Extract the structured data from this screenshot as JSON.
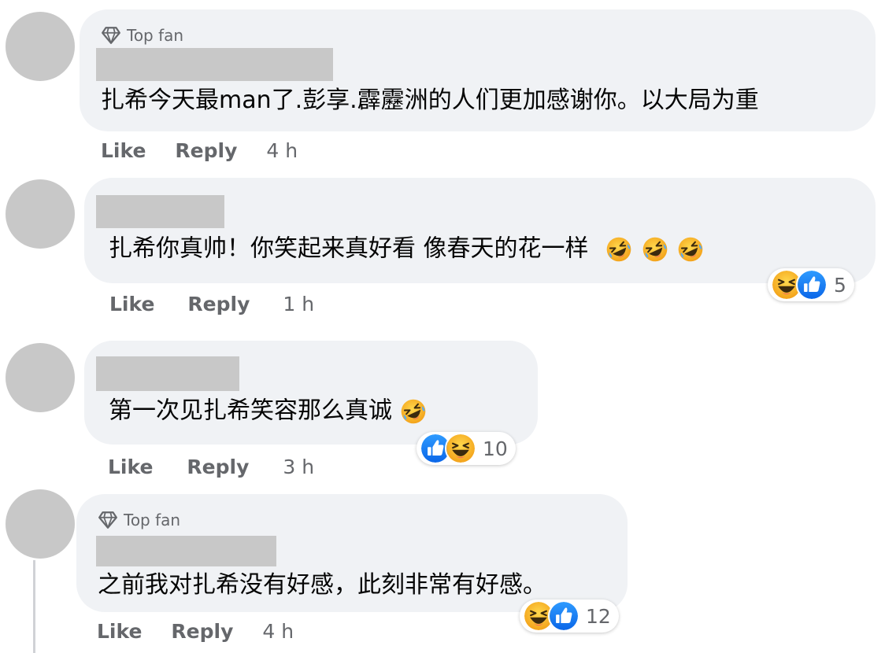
{
  "comments": [
    {
      "badge": "Top fan",
      "text": "扎希今天最man了.彭享.霹靂洲的人们更加感谢你。以大局为重",
      "like": "Like",
      "reply": "Reply",
      "time": "4 h"
    },
    {
      "text": "扎希你真帅！你笑起来真好看 像春天的花一样",
      "inline_emojis": [
        "rofl-emoji",
        "rofl-emoji",
        "rofl-emoji"
      ],
      "like": "Like",
      "reply": "Reply",
      "time": "1 h",
      "reactions": {
        "icons": [
          "haha-icon",
          "like-icon"
        ],
        "count": "5"
      }
    },
    {
      "text": "第一次见扎希笑容那么真诚",
      "inline_emojis": [
        "rofl-emoji"
      ],
      "like": "Like",
      "reply": "Reply",
      "time": "3 h",
      "reactions": {
        "icons": [
          "like-icon",
          "haha-icon"
        ],
        "count": "10"
      }
    },
    {
      "badge": "Top fan",
      "text": "之前我对扎希没有好感，此刻非常有好感。",
      "like": "Like",
      "reply": "Reply",
      "time": "4 h",
      "reactions": {
        "icons": [
          "haha-icon",
          "like-icon"
        ],
        "count": "12"
      }
    }
  ],
  "colors": {
    "bubble": "#f0f2f5",
    "placeholder": "#c8c8c8",
    "secondary_text": "#65676b",
    "like_blue": "#1877f2",
    "haha_yellow": "#f7b125"
  }
}
